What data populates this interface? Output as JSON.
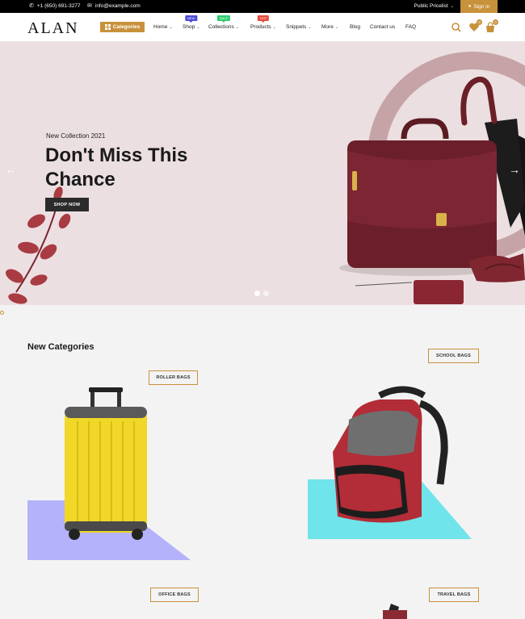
{
  "topbar": {
    "phone": "+1 (650) 691-3277",
    "email": "info@example.com",
    "pricelist": "Public Pricelist",
    "signin": "Sign in"
  },
  "header": {
    "logo": "ALAN",
    "categories": "Categories",
    "nav": [
      {
        "label": "Home",
        "chevron": true
      },
      {
        "label": "Shop",
        "chevron": true,
        "tag": "NEW",
        "tag_color": "#4b4bd8"
      },
      {
        "label": "Collections",
        "chevron": true,
        "tag": "SALE",
        "tag_color": "#2ecc71"
      },
      {
        "label": "Products",
        "chevron": true,
        "tag": "HOT",
        "tag_color": "#e74c3c"
      },
      {
        "label": "Snippets",
        "chevron": true
      },
      {
        "label": "More",
        "chevron": true
      },
      {
        "label": "Blog",
        "chevron": false
      },
      {
        "label": "Contact us",
        "chevron": false
      },
      {
        "label": "FAQ",
        "chevron": false
      }
    ],
    "wishlist_count": "0",
    "cart_count": "0"
  },
  "hero": {
    "eyebrow": "New Collection 2021",
    "title": "Don't Miss This Chance",
    "button": "SHOP NOW",
    "slides": 2,
    "active_slide": 1
  },
  "categories": {
    "title": "New Categories",
    "items": [
      "ROLLER BAGS",
      "SCHOOL BAGS",
      "OFFICE BAGS",
      "TRAVEL BAGS"
    ]
  },
  "colors": {
    "accent": "#c8913b",
    "hero_bg": "#ecdfe1",
    "roller_shadow": "#b3b2fb",
    "school_shadow": "#6fe4ea"
  }
}
